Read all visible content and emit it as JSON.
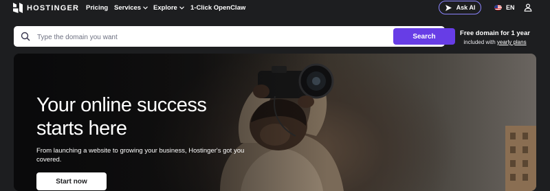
{
  "brand": {
    "name": "HOSTINGER"
  },
  "nav": {
    "links": [
      {
        "label": "Pricing"
      },
      {
        "label": "Services",
        "has_dropdown": true
      },
      {
        "label": "Explore",
        "has_dropdown": true
      },
      {
        "label": "1-Click OpenClaw"
      }
    ],
    "ask_ai_label": "Ask AI",
    "language": "EN",
    "icons": {
      "ask_ai": "sparkle-icon",
      "language": "us-flag-icon",
      "account": "user-icon"
    }
  },
  "search": {
    "placeholder": "Type the domain you want",
    "value": "",
    "button_label": "Search",
    "icon": "search-icon"
  },
  "promo": {
    "title": "Free domain for 1 year",
    "subtitle_prefix": "included with",
    "subtitle_link": "yearly plans"
  },
  "hero": {
    "title": "Your online success starts here",
    "subtitle": "From launching a website to growing your business, Hostinger's got you covered.",
    "cta_label": "Start now"
  },
  "colors": {
    "background": "#1d1e20",
    "accent": "#673de6",
    "ask_ai_border": "#8c85ff"
  }
}
